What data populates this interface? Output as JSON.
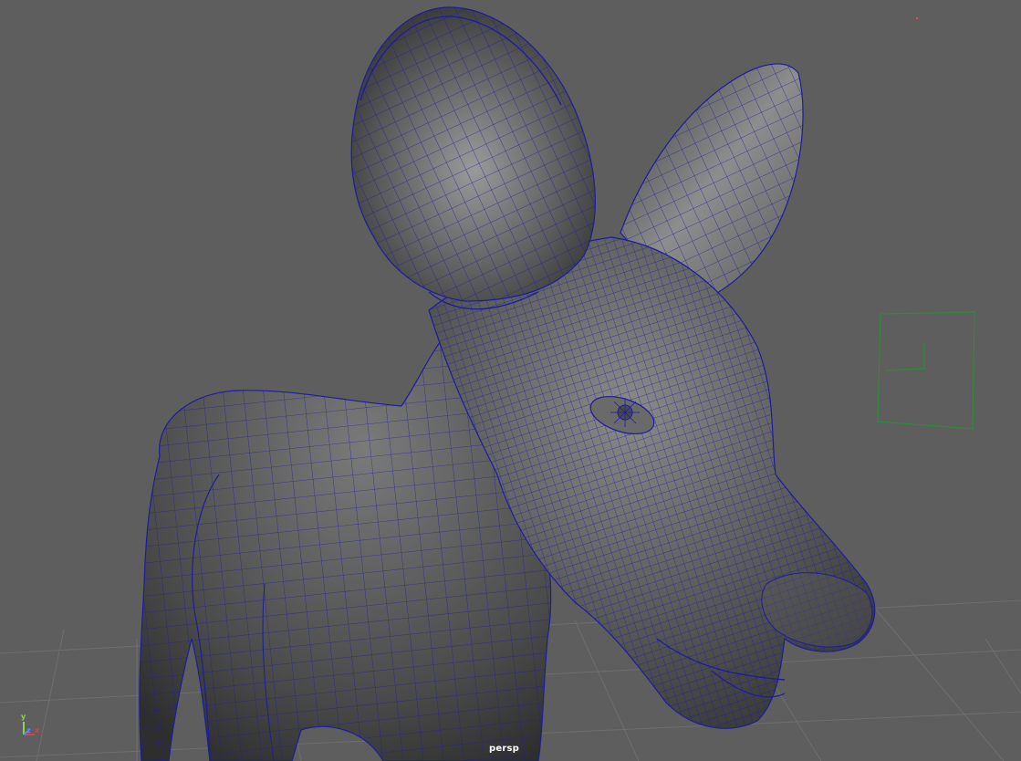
{
  "viewport": {
    "camera_name": "persp",
    "background_color": "#5e5e5e",
    "wireframe_color": "#1d1d9c",
    "grid_color": "#6f6f6f"
  },
  "axis_gizmo": {
    "y_label": "y",
    "x_label": "x",
    "z_label": "z"
  }
}
